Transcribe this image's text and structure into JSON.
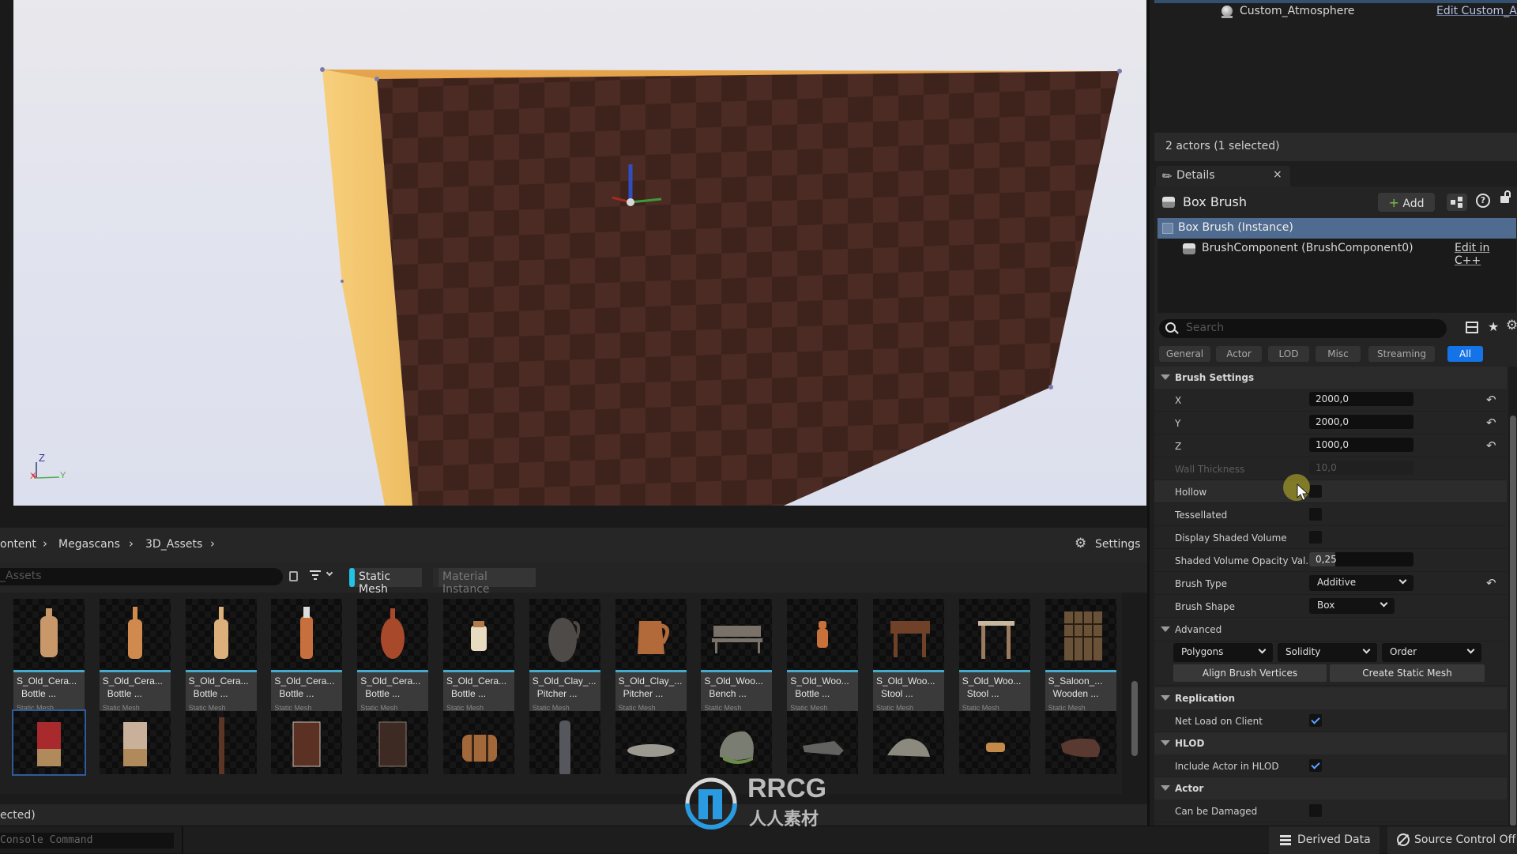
{
  "viewport": {
    "axis_labels": {
      "z": "Z",
      "x": "X",
      "y": "Y"
    },
    "colors": {
      "sky": "#e2e4ee",
      "wall_face": "#4a2a22",
      "wall_side": "#f2c572",
      "wall_top": "#e8a64c"
    }
  },
  "outliner": {
    "row": {
      "name": "Custom_Atmosphere",
      "action": "Edit Custom_Atm"
    },
    "actor_count": "2 actors (1 selected)"
  },
  "details": {
    "tab_label": "Details",
    "actor_name": "Box Brush",
    "add_label": "Add",
    "tree": [
      {
        "label": "Box Brush (Instance)",
        "selected": true
      },
      {
        "label": "BrushComponent (BrushComponent0)",
        "action": "Edit in C++"
      }
    ],
    "search_placeholder": "Search",
    "filter_tabs": [
      {
        "label": "General",
        "active": false
      },
      {
        "label": "Actor",
        "active": false
      },
      {
        "label": "LOD",
        "active": false
      },
      {
        "label": "Misc",
        "active": false
      },
      {
        "label": "Streaming",
        "active": false
      },
      {
        "label": "All",
        "active": true
      }
    ],
    "brush_settings": {
      "title": "Brush Settings",
      "x": {
        "label": "X",
        "value": "2000,0"
      },
      "y": {
        "label": "Y",
        "value": "2000,0"
      },
      "z": {
        "label": "Z",
        "value": "1000,0"
      },
      "wall_thickness": {
        "label": "Wall Thickness",
        "value": "10,0"
      },
      "hollow": {
        "label": "Hollow",
        "checked": false
      },
      "tessellated": {
        "label": "Tessellated",
        "checked": false
      },
      "display_shaded_volume": {
        "label": "Display Shaded Volume",
        "checked": false
      },
      "opacity": {
        "label": "Shaded Volume Opacity Val...",
        "value": "0,25",
        "fraction": 0.25
      },
      "brush_type": {
        "label": "Brush Type",
        "value": "Additive"
      },
      "brush_shape": {
        "label": "Brush Shape",
        "value": "Box"
      }
    },
    "advanced": {
      "title": "Advanced",
      "dropdowns": [
        "Polygons",
        "Solidity",
        "Order"
      ],
      "buttons": [
        "Align Brush Vertices",
        "Create Static Mesh"
      ]
    },
    "replication": {
      "title": "Replication",
      "net_load": {
        "label": "Net Load on Client",
        "checked": true
      }
    },
    "hlod": {
      "title": "HLOD",
      "include": {
        "label": "Include Actor in HLOD",
        "checked": true
      }
    },
    "actor": {
      "title": "Actor",
      "can_be_damaged": {
        "label": "Can be Damaged",
        "checked": false
      }
    }
  },
  "content_browser": {
    "breadcrumb": [
      "ontent",
      "Megascans",
      "3D_Assets"
    ],
    "settings_label": "Settings",
    "search_value": "_Assets",
    "type_filters": [
      {
        "label": "Static Mesh",
        "color": "#22c4e6",
        "active": true
      },
      {
        "label": "Material Instance",
        "color": "#3a3a3a",
        "active": false
      }
    ],
    "assets_row1": [
      {
        "name": "S_Old_Cera...",
        "name2": "Bottle ...",
        "type": "Static Mesh",
        "thumb": "bottle-wide",
        "color": "#c9986a"
      },
      {
        "name": "S_Old_Cera...",
        "name2": "Bottle ...",
        "type": "Static Mesh",
        "thumb": "bottle-slim",
        "color": "#d08a4e"
      },
      {
        "name": "S_Old_Cera...",
        "name2": "Bottle ...",
        "type": "Static Mesh",
        "thumb": "bottle-slim",
        "color": "#dcb07a"
      },
      {
        "name": "S_Old_Cera...",
        "name2": "Bottle ...",
        "type": "Static Mesh",
        "thumb": "bottle-tall",
        "color": "#c7703e"
      },
      {
        "name": "S_Old_Cera...",
        "name2": "Bottle ...",
        "type": "Static Mesh",
        "thumb": "bottle-round",
        "color": "#a8492c"
      },
      {
        "name": "S_Old_Cera...",
        "name2": "Bottle ...",
        "type": "Static Mesh",
        "thumb": "bottle-short",
        "color": "#e8dcc0"
      },
      {
        "name": "S_Old_Clay_...",
        "name2": "Pitcher ...",
        "type": "Static Mesh",
        "thumb": "jug",
        "color": "#4d4a48"
      },
      {
        "name": "S_Old_Clay_...",
        "name2": "Pitcher ...",
        "type": "Static Mesh",
        "thumb": "pitcher",
        "color": "#b26a3a"
      },
      {
        "name": "S_Old_Woo...",
        "name2": "Bench ...",
        "type": "Static Mesh",
        "thumb": "bench",
        "color": "#7a7268"
      },
      {
        "name": "S_Old_Woo...",
        "name2": "Bottle ...",
        "type": "Static Mesh",
        "thumb": "bottle-small",
        "color": "#c8713a"
      },
      {
        "name": "S_Old_Woo...",
        "name2": "Stool ...",
        "type": "Static Mesh",
        "thumb": "table",
        "color": "#6e4128"
      },
      {
        "name": "S_Old_Woo...",
        "name2": "Stool ...",
        "type": "Static Mesh",
        "thumb": "stool",
        "color": "#9c7a5e"
      },
      {
        "name": "S_Saloon_...",
        "name2": "Wooden ...",
        "type": "Static Mesh",
        "thumb": "cabinet",
        "color": "#6a5238"
      }
    ],
    "assets_row2": [
      {
        "thumb": "panel-red",
        "color": "#a82a2c",
        "selected": true
      },
      {
        "thumb": "panel-white",
        "color": "#c9b09a"
      },
      {
        "thumb": "pillar",
        "color": "#5b3626"
      },
      {
        "thumb": "door",
        "color": "#5a3122"
      },
      {
        "thumb": "door-dark",
        "color": "#3d2a22"
      },
      {
        "thumb": "chest",
        "color": "#a3683a"
      },
      {
        "thumb": "vase",
        "color": "#55575c"
      },
      {
        "thumb": "rock-flat",
        "color": "#9c9a90"
      },
      {
        "thumb": "rock-mossy",
        "color": "#7a7d72"
      },
      {
        "thumb": "rock-slab",
        "color": "#626260"
      },
      {
        "thumb": "rock-mound",
        "color": "#8c897e"
      },
      {
        "thumb": "bowl",
        "color": "#c48a4a"
      },
      {
        "thumb": "bag",
        "color": "#5a3a30"
      }
    ],
    "status": "ected)"
  },
  "statusbar": {
    "console_placeholder": "Console Command",
    "derived_data": "Derived Data",
    "source_control": "Source Control Off"
  },
  "watermark": {
    "brand": "RRCG",
    "sub": "人人素材",
    "color": "#2a9be0"
  }
}
